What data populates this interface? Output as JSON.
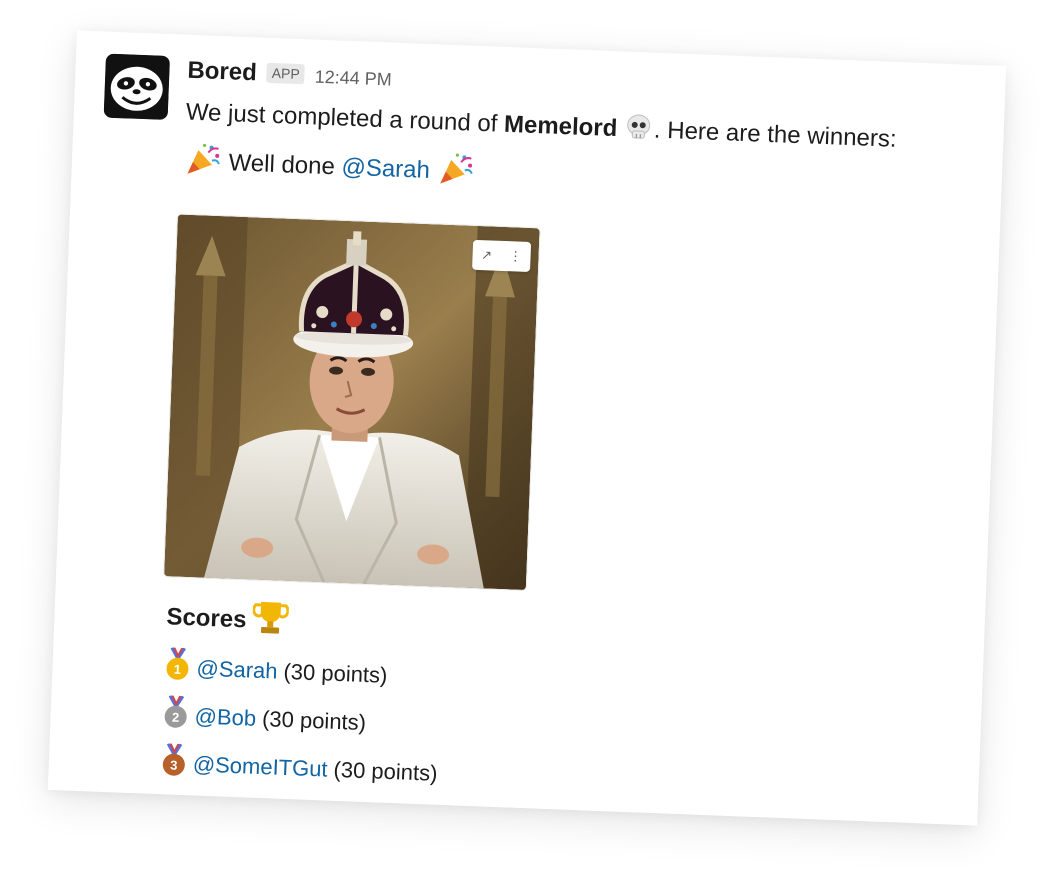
{
  "message": {
    "sender": "Bored",
    "badge": "APP",
    "time": "12:44 PM",
    "line1_prefix": "We just completed a round of",
    "game_name": "Memelord",
    "line1_suffix": ". Here are the winners:",
    "line2_text": "Well done",
    "winner_mention": "@Sarah"
  },
  "image": {
    "alt": "king-meme-gif",
    "actions": [
      "open-in-new",
      "more-actions"
    ]
  },
  "scores": {
    "title": "Scores",
    "rows": [
      {
        "medal": "1",
        "user": "@Sarah",
        "points": "(30 points)"
      },
      {
        "medal": "2",
        "user": "@Bob",
        "points": "(30 points)"
      },
      {
        "medal": "3",
        "user": "@SomeITGut",
        "points": "(30 points)"
      }
    ]
  },
  "colors": {
    "mention": "#1264a3",
    "text": "#1d1c1d",
    "muted": "#616061",
    "gold": "#f2b705",
    "silver": "#9a9a9a",
    "bronze": "#b8602a"
  },
  "icons": {
    "avatar": "sloth-face-icon",
    "game": "skull-icon",
    "party": "party-popper-icon",
    "trophy": "trophy-icon",
    "open": "external-link-icon",
    "more": "vertical-ellipsis-icon"
  }
}
